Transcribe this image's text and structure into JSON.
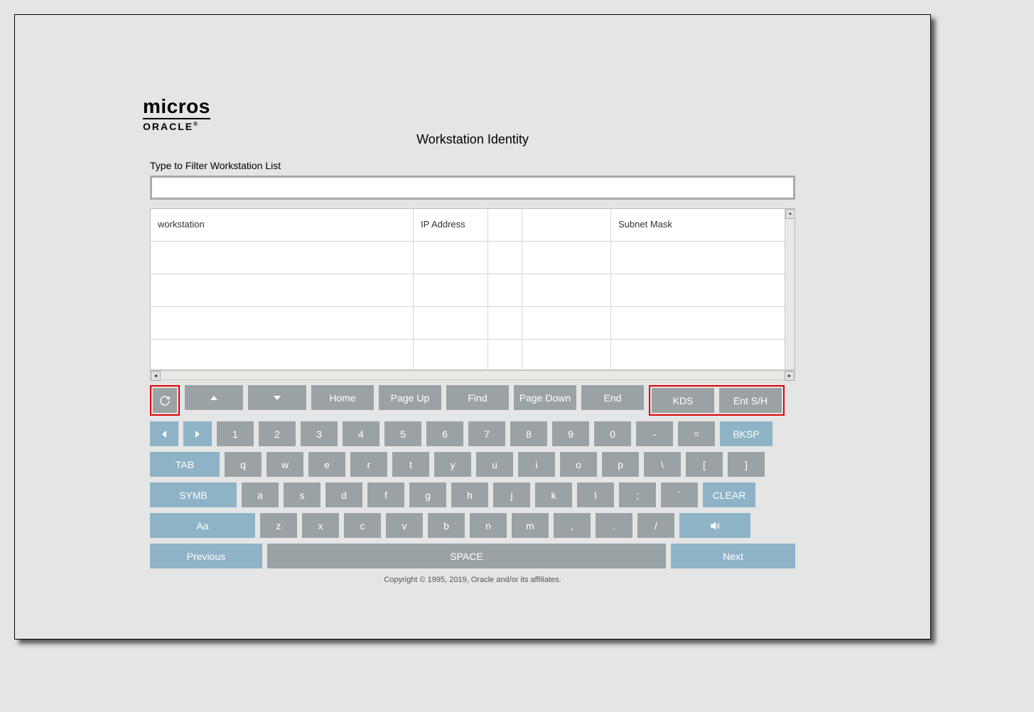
{
  "logo": {
    "line1": "micros",
    "line2": "ORACLE"
  },
  "title": "Workstation Identity",
  "filter_label": "Type to Filter Workstation List",
  "filter_value": "",
  "table": {
    "headers": {
      "col1": "workstation",
      "col2": "IP Address",
      "col3": "",
      "col4": "",
      "col5": "Subnet Mask"
    }
  },
  "nav": {
    "refresh": "↻",
    "up": "▲",
    "down": "▼",
    "home": "Home",
    "page_up": "Page Up",
    "find": "Find",
    "page_down": "Page Down",
    "end": "End",
    "kds": "KDS",
    "ent": "Ent S/H"
  },
  "kb": {
    "row1": {
      "left": "◄",
      "right": "►",
      "k1": "1",
      "k2": "2",
      "k3": "3",
      "k4": "4",
      "k5": "5",
      "k6": "6",
      "k7": "7",
      "k8": "8",
      "k9": "9",
      "k0": "0",
      "dash": "-",
      "eq": "=",
      "bksp": "BKSP"
    },
    "row2": {
      "tab": "TAB",
      "q": "q",
      "w": "w",
      "e": "e",
      "r": "r",
      "t": "t",
      "y": "y",
      "u": "u",
      "i": "i",
      "o": "o",
      "p": "p",
      "bs": "\\",
      "lb": "[",
      "rb": "]"
    },
    "row3": {
      "symb": "SYMB",
      "a": "a",
      "s": "s",
      "d": "d",
      "f": "f",
      "g": "g",
      "h": "h",
      "j": "j",
      "k": "k",
      "l": "l",
      "semi": ";",
      "tick": "`",
      "clear": "CLEAR"
    },
    "row4": {
      "shift": "Aa",
      "z": "z",
      "x": "x",
      "c": "c",
      "v": "v",
      "b": "b",
      "n": "n",
      "m": "m",
      "comma": ",",
      "dot": ".",
      "slash": "/",
      "sound": "◄))"
    },
    "row5": {
      "prev": "Previous",
      "space": "SPACE",
      "next": "Next"
    }
  },
  "footer": "Copyright © 1995, 2019, Oracle and/or its affiliates."
}
